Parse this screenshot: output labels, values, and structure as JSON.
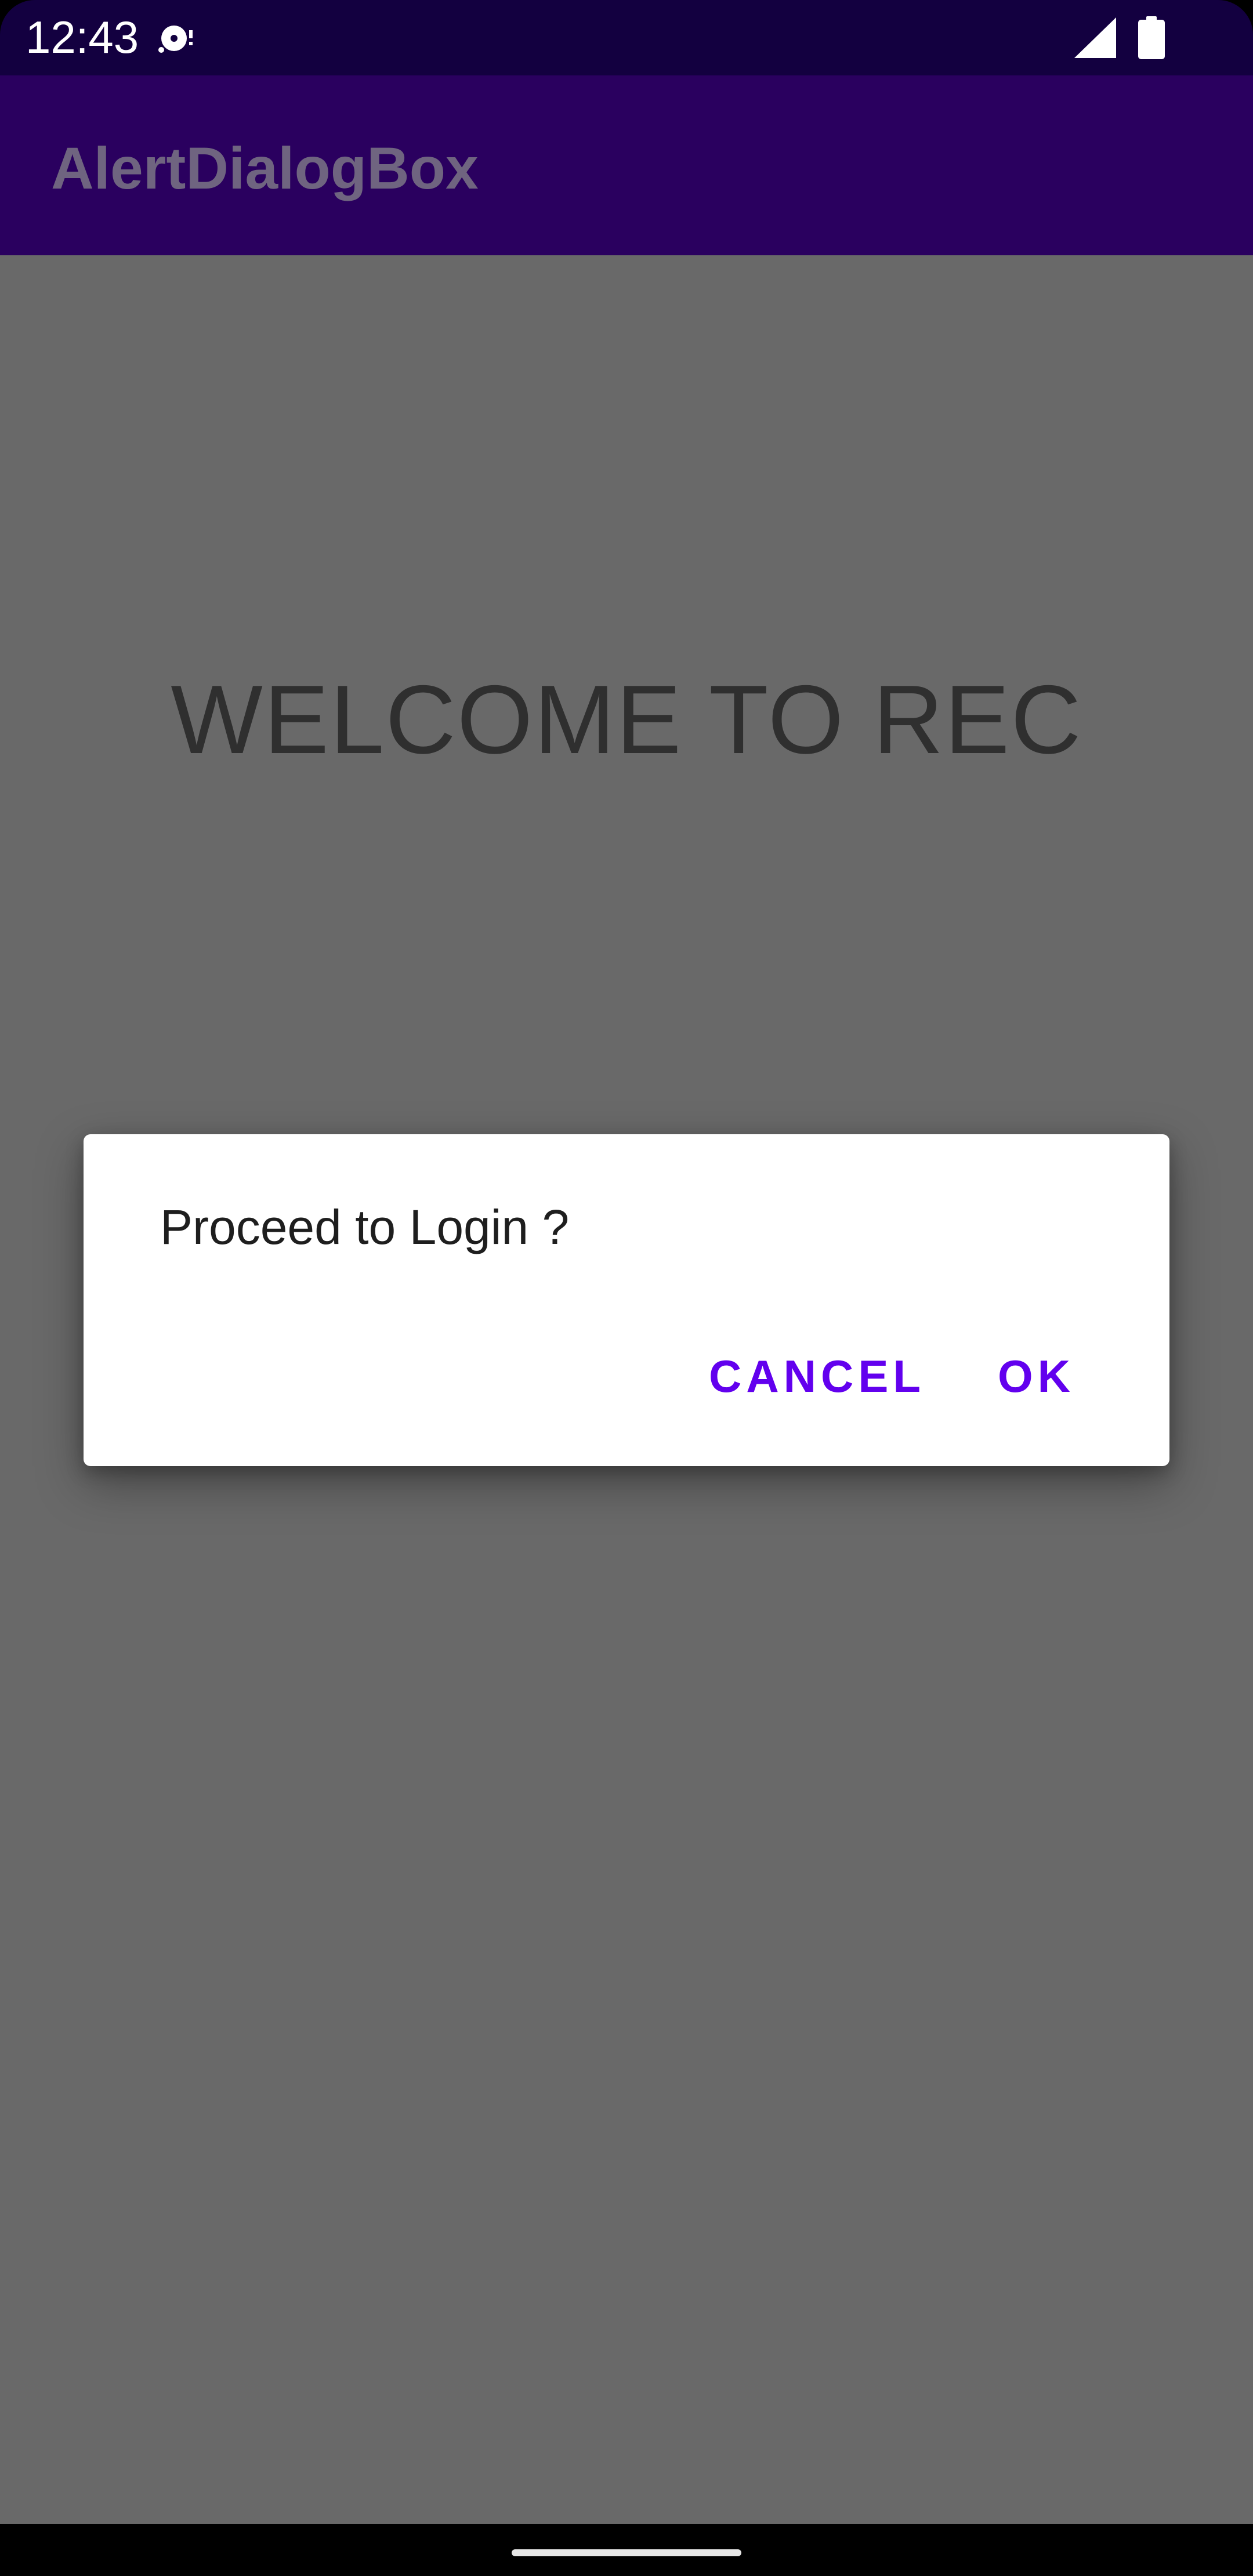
{
  "status_bar": {
    "time": "12:43",
    "icons": [
      "media-record-icon",
      "cell-signal-icon",
      "battery-icon"
    ]
  },
  "app_bar": {
    "title": "AlertDialogBox"
  },
  "content": {
    "welcome_text": "WELCOME TO REC"
  },
  "dialog": {
    "message": "Proceed to Login ?",
    "cancel_label": "CANCEL",
    "ok_label": "OK"
  },
  "colors": {
    "status_bar": "#130040",
    "app_bar": "#2a005f",
    "scrim_content": "#696969",
    "dialog_bg": "#ffffff",
    "accent": "#6200ee",
    "nav_bar": "#000000"
  }
}
